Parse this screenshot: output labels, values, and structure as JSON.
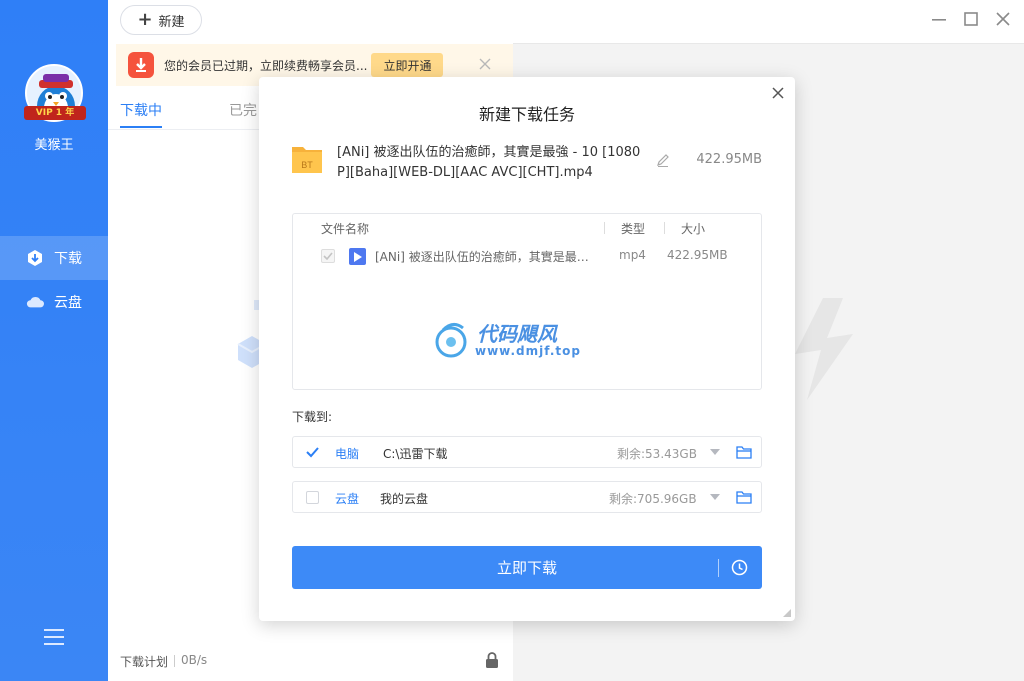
{
  "toolbar": {
    "new_label": "新建"
  },
  "sidebar": {
    "vip_badge": "VIP 1 年",
    "username": "美猴王",
    "items": [
      {
        "label": "下载",
        "icon": "download-icon",
        "active": true
      },
      {
        "label": "云盘",
        "icon": "cloud-icon",
        "active": false
      }
    ]
  },
  "banner": {
    "text": "您的会员已过期，立即续费畅享会员...",
    "button": "立即开通"
  },
  "tabs": [
    {
      "label": "下载中",
      "active": true
    },
    {
      "label": "已完",
      "active": false
    }
  ],
  "footer": {
    "plan": "下载计划",
    "speed": "0B/s"
  },
  "dialog": {
    "title": "新建下载任务",
    "file_title": "[ANi] 被逐出队伍的治癒師，其實是最強 - 10 [1080P][Baha][WEB-DL][AAC AVC][CHT].mp4",
    "file_size": "422.95MB",
    "bt_label": "BT",
    "table": {
      "headers": {
        "name": "文件名称",
        "type": "类型",
        "size": "大小"
      },
      "rows": [
        {
          "name": "[ANi] 被逐出队伍的治癒師，其實是最強 - 10 [1080P][Baha][WEB-DL][AAC AVC][CHT].mp4",
          "type": "mp4",
          "size": "422.95MB",
          "checked": true
        }
      ]
    },
    "watermark": {
      "title": "代码飓风",
      "url": "www.dmjf.top"
    },
    "download_to_label": "下载到:",
    "destinations": [
      {
        "name": "电脑",
        "path": "C:\\迅雷下载",
        "free": "剩余:53.43GB",
        "checked": true
      },
      {
        "name": "云盘",
        "path": "我的云盘",
        "free": "剩余:705.96GB",
        "checked": false
      }
    ],
    "download_button": "立即下载"
  },
  "colors": {
    "accent": "#2b7ff5",
    "sidebar": "#2f7ff7",
    "banner_bg": "#fff7e8",
    "banner_btn": "#ffd98a"
  }
}
